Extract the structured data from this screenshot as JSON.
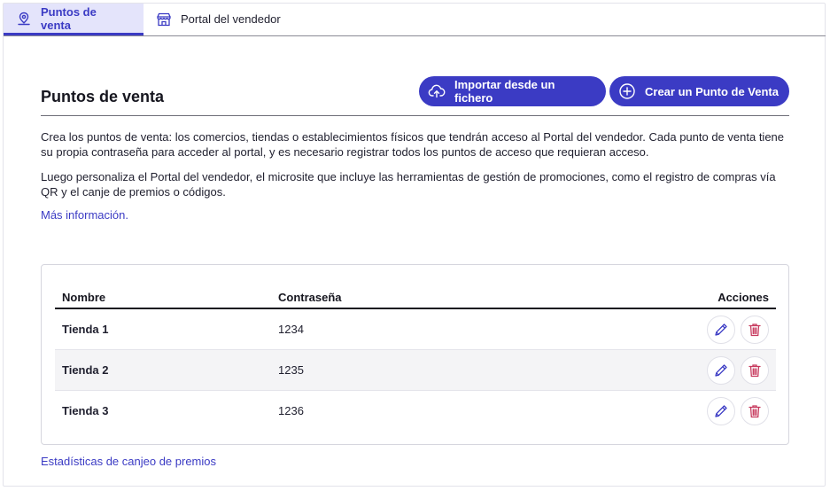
{
  "tabs": [
    {
      "label": "Puntos de venta",
      "icon": "map-pin-icon",
      "active": true
    },
    {
      "label": "Portal del vendedor",
      "icon": "store-icon",
      "active": false
    }
  ],
  "header": {
    "title": "Puntos de venta",
    "import_label": "Importar desde un fichero",
    "create_label": "Crear un Punto de Venta"
  },
  "description": {
    "p1": "Crea los puntos de venta: los comercios, tiendas o establecimientos físicos que tendrán acceso al Portal del vendedor. Cada punto de venta tiene su propia contraseña para acceder al portal, y es necesario registrar todos los puntos de acceso que requieran acceso.",
    "p2": "Luego personaliza el Portal del vendedor, el microsite que incluye las herramientas de gestión de promociones, como el registro de compras vía QR y el canje de premios o códigos.",
    "more_link": "Más información",
    "more_suffix": "."
  },
  "table": {
    "headers": {
      "name": "Nombre",
      "password": "Contraseña",
      "actions": "Acciones"
    },
    "rows": [
      {
        "name": "Tienda 1",
        "password": "1234"
      },
      {
        "name": "Tienda 2",
        "password": "1235"
      },
      {
        "name": "Tienda 3",
        "password": "1236"
      }
    ]
  },
  "footer": {
    "stats_link": "Estadísticas de canjeo de premios"
  },
  "colors": {
    "accent": "#3b3bc4",
    "active_tab_bg": "#e4e4fb",
    "delete": "#c73a5e"
  }
}
